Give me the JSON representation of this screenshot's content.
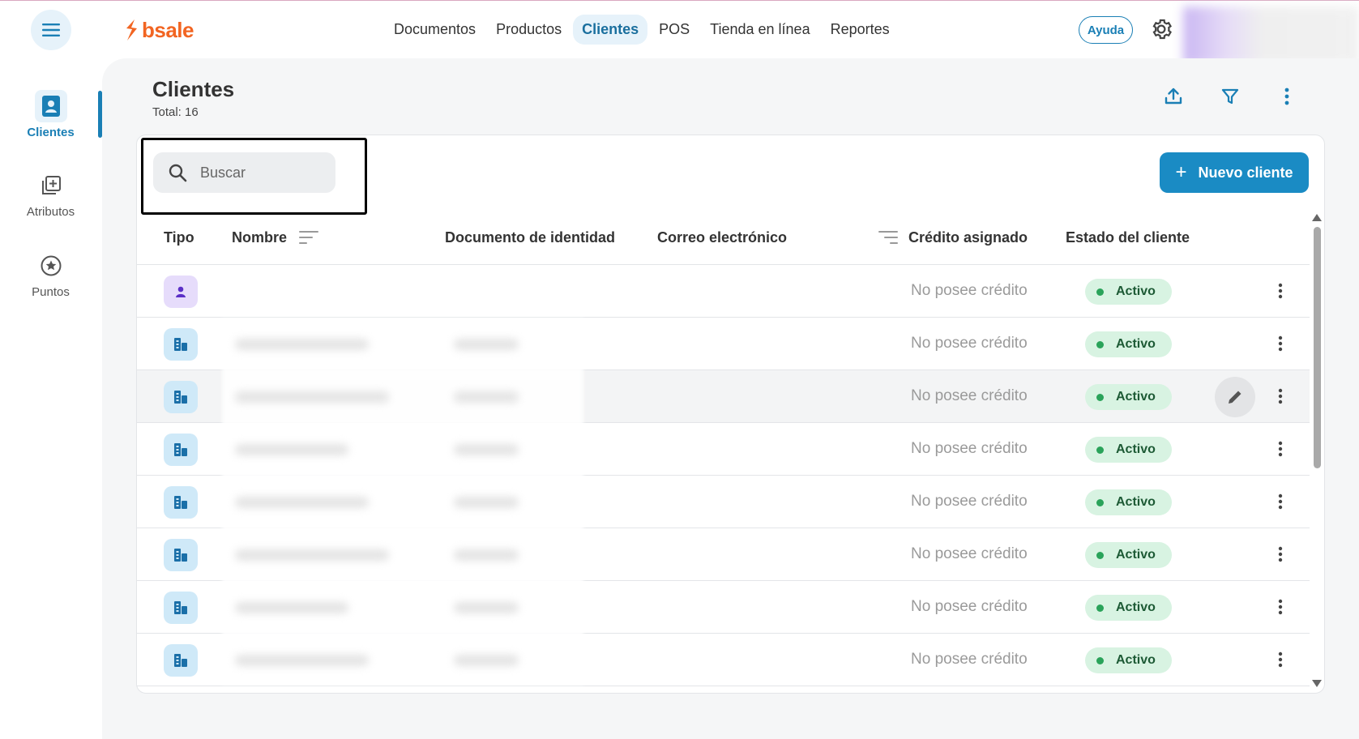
{
  "brand": {
    "name": "bsale",
    "color": "#f26522"
  },
  "top_nav": {
    "items": [
      {
        "label": "Documentos",
        "active": false
      },
      {
        "label": "Productos",
        "active": false
      },
      {
        "label": "Clientes",
        "active": true
      },
      {
        "label": "POS",
        "active": false
      },
      {
        "label": "Tienda en línea",
        "active": false
      },
      {
        "label": "Reportes",
        "active": false
      }
    ],
    "help_label": "Ayuda"
  },
  "sidebar": {
    "items": [
      {
        "label": "Clientes",
        "icon": "contact-card-icon",
        "active": true
      },
      {
        "label": "Atributos",
        "icon": "add-attribute-icon",
        "active": false
      },
      {
        "label": "Puntos",
        "icon": "star-circle-icon",
        "active": false
      }
    ]
  },
  "page": {
    "title": "Clientes",
    "total": "Total: 16"
  },
  "toolbar": {
    "search_placeholder": "Buscar",
    "new_button_label": "Nuevo cliente"
  },
  "table": {
    "columns": [
      "Tipo",
      "Nombre",
      "Documento de identidad",
      "Correo electrónico",
      "Crédito asignado",
      "Estado del cliente"
    ],
    "rows": [
      {
        "type": "person",
        "credit": "No posee crédito",
        "status": "Activo"
      },
      {
        "type": "company",
        "credit": "No posee crédito",
        "status": "Activo"
      },
      {
        "type": "company",
        "credit": "No posee crédito",
        "status": "Activo"
      },
      {
        "type": "company",
        "credit": "No posee crédito",
        "status": "Activo"
      },
      {
        "type": "company",
        "credit": "No posee crédito",
        "status": "Activo"
      },
      {
        "type": "company",
        "credit": "No posee crédito",
        "status": "Activo"
      },
      {
        "type": "company",
        "credit": "No posee crédito",
        "status": "Activo"
      },
      {
        "type": "company",
        "credit": "No posee crédito",
        "status": "Activo"
      }
    ]
  },
  "colors": {
    "accent": "#1a8bc4",
    "active_badge_bg": "#d8f3e2",
    "active_dot": "#2aa35a"
  }
}
